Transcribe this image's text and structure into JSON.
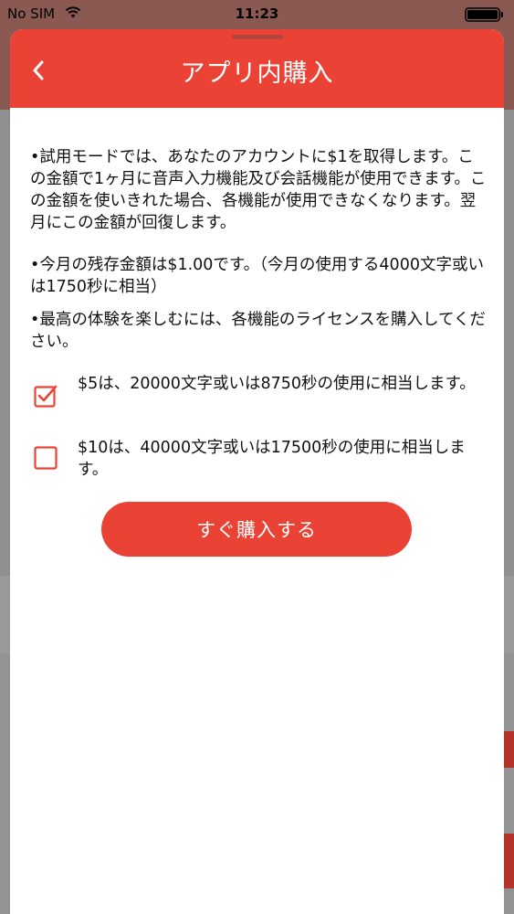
{
  "status_bar": {
    "carrier": "No SIM",
    "time": "11:23",
    "wifi_icon": "wifi-icon",
    "battery_icon": "battery-icon"
  },
  "header": {
    "title": "アプリ内購入",
    "back_icon": "chevron-left-icon"
  },
  "content": {
    "paragraph_1": "•試用モードでは、あなたのアカウントに$1を取得します。この金額で1ヶ月に音声入力機能及び会話機能が使用できます。この金額を使いきれた場合、各機能が使用できなくなります。翌月にこの金額が回復します。",
    "paragraph_2": "•今月の残存金額は$1.00です。（今月の使用する4000文字或いは1750秒に相当）",
    "paragraph_3": "•最高の体験を楽しむには、各機能のライセンスを購入してください。"
  },
  "options": [
    {
      "label": "$5は、20000文字或いは8750秒の使用に相当します。",
      "checked": true
    },
    {
      "label": "$10は、40000文字或いは17500秒の使用に相当します。",
      "checked": false
    }
  ],
  "buy_button": {
    "label": "すぐ購入する"
  },
  "colors": {
    "accent": "#ea4335",
    "text": "#111111"
  }
}
